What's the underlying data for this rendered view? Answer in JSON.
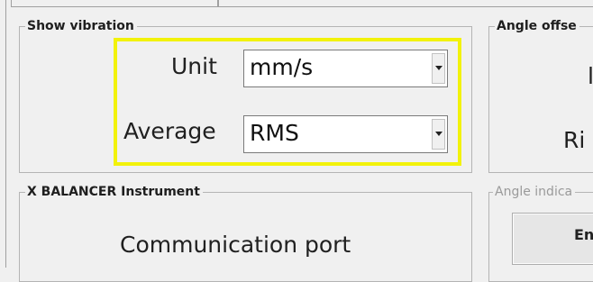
{
  "show_vibration": {
    "title": "Show vibration",
    "unit": {
      "label": "Unit",
      "value": "mm/s"
    },
    "average": {
      "label": "Average",
      "value": "RMS"
    }
  },
  "angle_offset": {
    "title": "Angle offse",
    "line1": "l",
    "line2": "Ri"
  },
  "instrument": {
    "title": "X BALANCER Instrument",
    "comm_label": "Communication port"
  },
  "angle_indicator": {
    "title": "Angle indica",
    "button_label": "En"
  },
  "colors": {
    "highlight": "#f2f20a",
    "background": "#f0f0f0"
  }
}
